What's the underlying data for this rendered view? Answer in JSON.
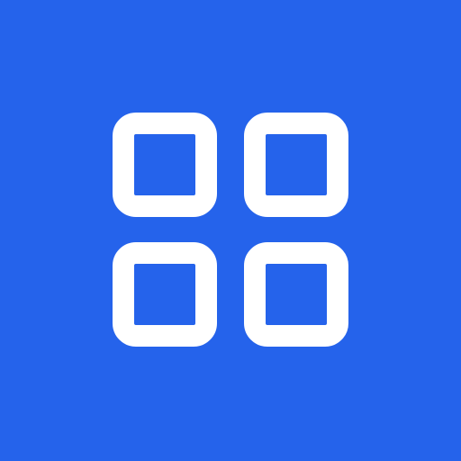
{
  "icon": {
    "name": "app-grid-icon",
    "background_color": "#2563EB",
    "foreground_color": "#FFFFFF",
    "tiles": [
      {
        "name": "grid-square-icon"
      },
      {
        "name": "grid-square-icon"
      },
      {
        "name": "grid-square-icon"
      },
      {
        "name": "grid-square-icon"
      }
    ]
  }
}
